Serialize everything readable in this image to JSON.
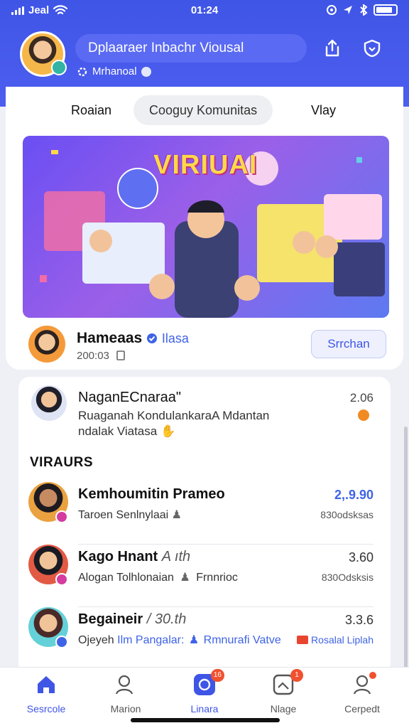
{
  "status_bar": {
    "carrier": "Jeal",
    "time": "01:24"
  },
  "header": {
    "search_text": "Dplaaraer Inbachr Viousal",
    "sub_label": "Mrhanoal"
  },
  "tabs": [
    {
      "label": "Roaian"
    },
    {
      "label": "Cooguy Komunitas"
    },
    {
      "label": "Vlay"
    }
  ],
  "banner": {
    "title": "VIRIUAI"
  },
  "owner": {
    "name": "Hameaas",
    "tag": "Ilasa",
    "sub": "200:03",
    "follow_label": "Srrchan"
  },
  "post": {
    "author": "NaganECnaraa\"",
    "time": "2.06",
    "text": "Ruaganah KondulankaraA Mdantan ndalak Viatasa"
  },
  "section": {
    "title": "VIRAURS"
  },
  "rows": [
    {
      "name": "Kemhoumitin Prameo",
      "name_extra": "",
      "sub": "Taroen Senlnylaai",
      "sub_extra": "",
      "sub_blue": "",
      "value": "2,.9.90",
      "meta": "830odsksas"
    },
    {
      "name": "Kago Hnant",
      "name_extra": "A ıth",
      "sub": "Alogan Tolhlonaian",
      "sub_extra": "Frnnrioc",
      "sub_blue": "",
      "value": "3.60",
      "meta": "830Odsksis"
    },
    {
      "name": "Begaineir",
      "name_extra": "/ 30.th",
      "sub": "Ojeyeh",
      "sub_extra": "Rmnurafi Vatve",
      "sub_blue": "Ilm Pangalar:",
      "value": "3.3.6",
      "meta": "Rosalal Liplah"
    }
  ],
  "nav": [
    {
      "label": "Sesrcole",
      "badge": ""
    },
    {
      "label": "Marion",
      "badge": ""
    },
    {
      "label": "Linara",
      "badge": "16"
    },
    {
      "label": "Nlage",
      "badge": "1"
    },
    {
      "label": "Cerpedt",
      "badge": ""
    }
  ],
  "colors": {
    "accent": "#3f55e6",
    "header_bg": "#4d5ef0",
    "badge": "#f0512f"
  }
}
